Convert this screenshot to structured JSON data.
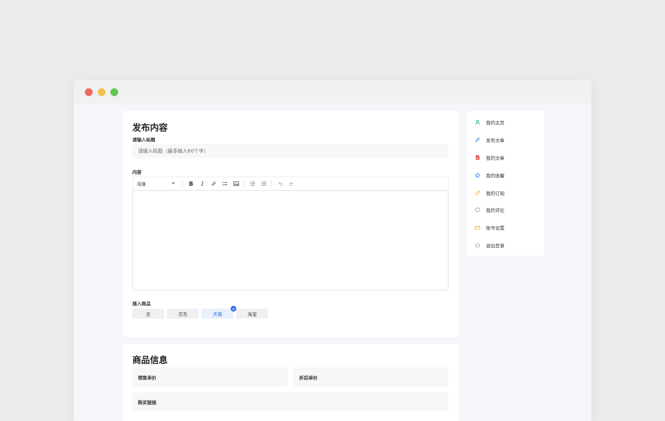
{
  "publish": {
    "heading": "发布内容",
    "title_label": "请输入标题",
    "title_placeholder": "请输入标题（最多输入60个字）",
    "content_label": "内容",
    "toolbar": {
      "paragraph_select": "段落",
      "bold": "B",
      "italic": "I"
    },
    "insert_label": "插入商品",
    "chips": [
      {
        "label": "无",
        "active": false
      },
      {
        "label": "京东",
        "active": false
      },
      {
        "label": "天猫",
        "active": true
      },
      {
        "label": "淘宝",
        "active": false
      }
    ]
  },
  "product_info": {
    "heading": "商品信息",
    "sale_price": "销售单价",
    "discount_price": "折后单价",
    "buy_link": "购买链接"
  },
  "sidebar": {
    "items": [
      {
        "label": "我的主页",
        "icon": "user-icon",
        "color": "#2db87d"
      },
      {
        "label": "发布文章",
        "icon": "pencil-icon",
        "color": "#3b7ae6"
      },
      {
        "label": "我的文章",
        "icon": "file-icon",
        "color": "#e55353"
      },
      {
        "label": "我的收藏",
        "icon": "star-icon",
        "color": "#3b7ae6"
      },
      {
        "label": "我的订阅",
        "icon": "tag-icon",
        "color": "#f1b53b"
      },
      {
        "label": "我的评论",
        "icon": "comment-icon",
        "color": "#8a97ad"
      },
      {
        "label": "账号设置",
        "icon": "card-icon",
        "color": "#f1b53b"
      },
      {
        "label": "退出登录",
        "icon": "power-icon",
        "color": "#8a97ad"
      }
    ]
  },
  "colors": {
    "accent": "#2f6fe4",
    "window_red": "#ed6a5e",
    "window_yellow": "#f4bf4f",
    "window_green": "#62c554"
  }
}
